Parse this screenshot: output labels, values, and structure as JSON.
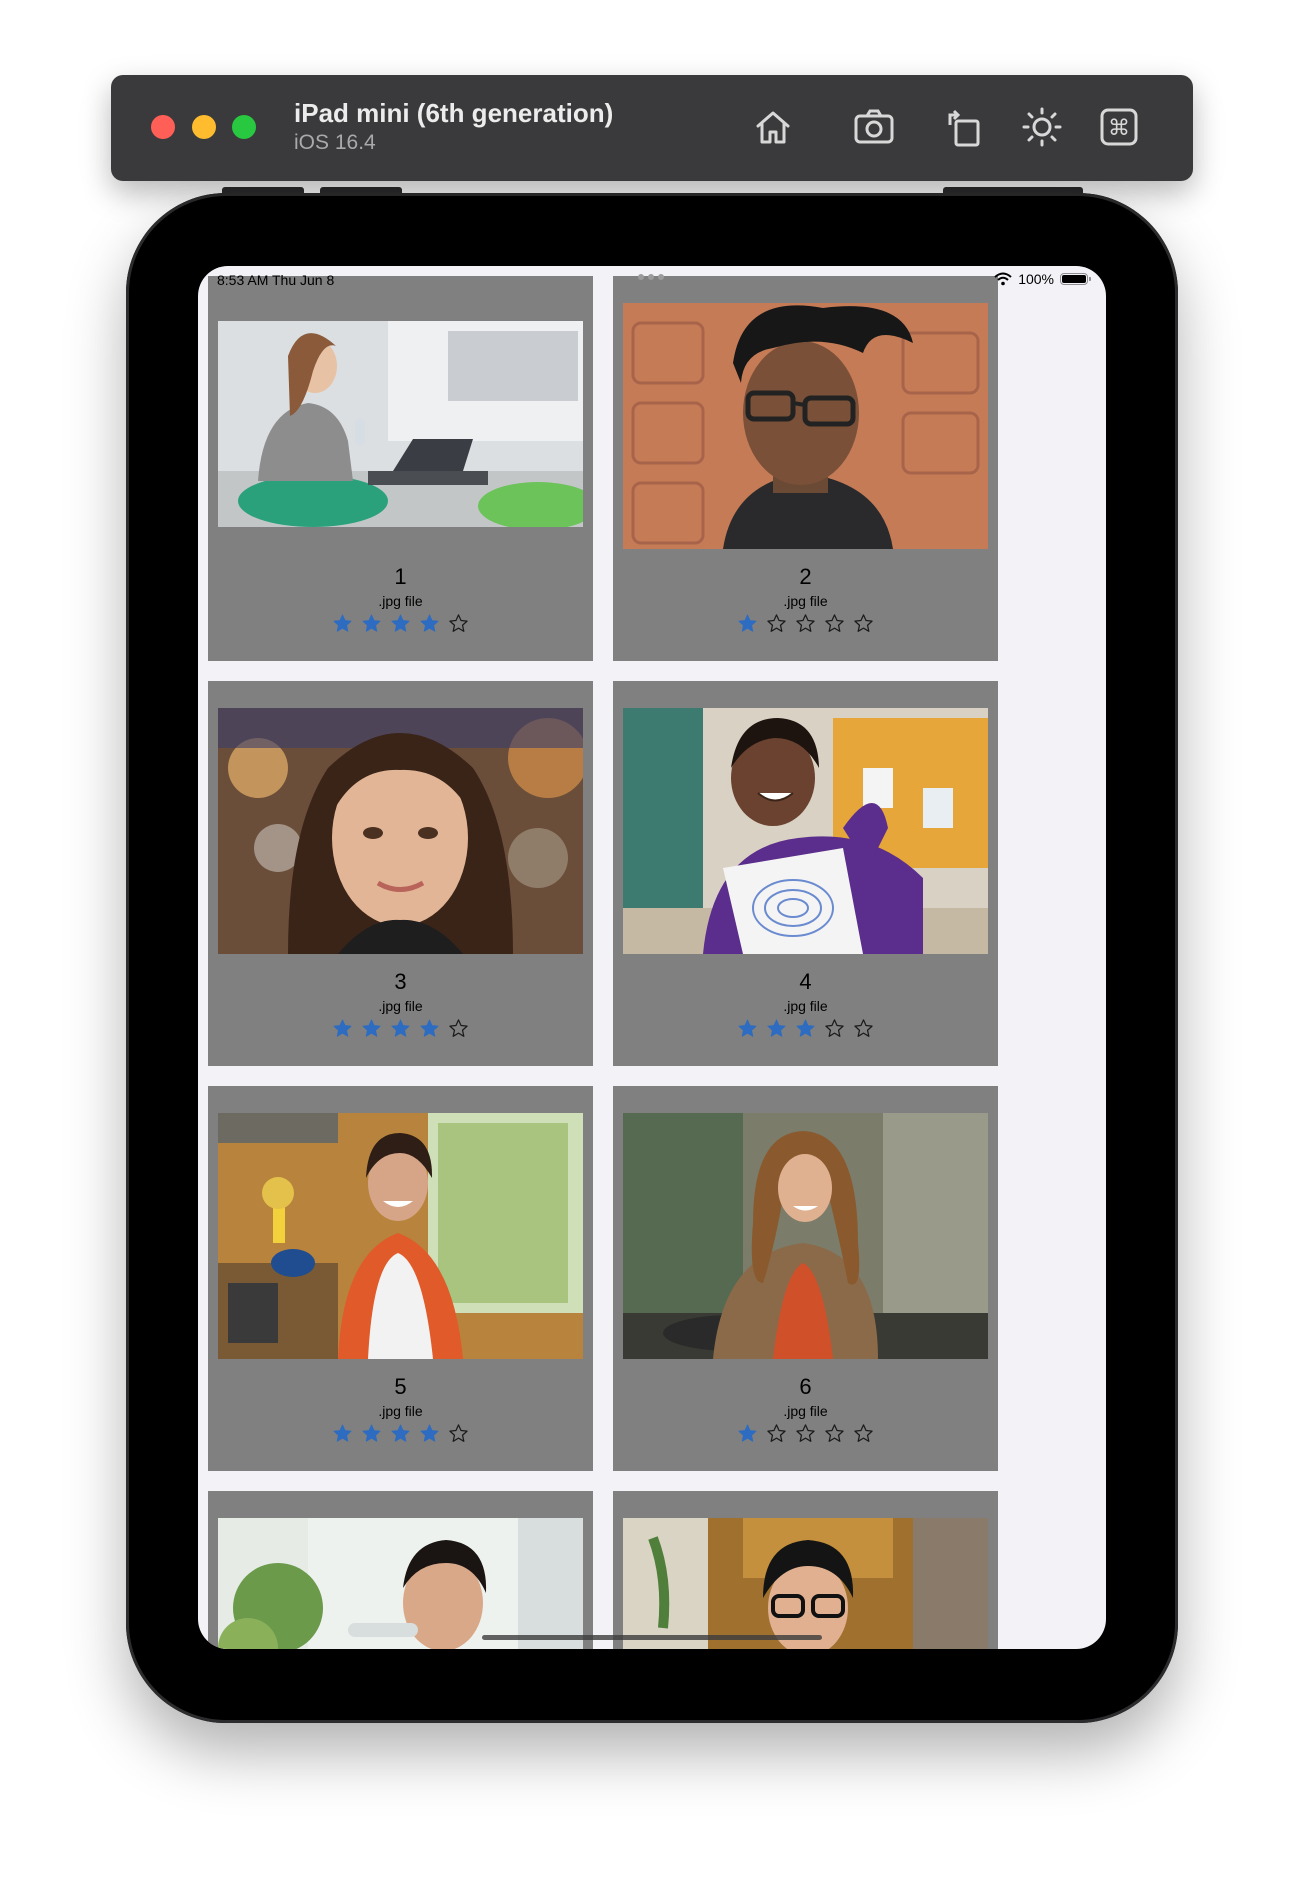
{
  "simulator": {
    "device_name": "iPad mini (6th generation)",
    "os_version": "iOS 16.4",
    "toolbar_icons": [
      "home-icon",
      "screenshot-icon",
      "rotate-icon",
      "appearance-icon",
      "command-icon"
    ]
  },
  "status_bar": {
    "time_date": "8:53 AM   Thu Jun 8",
    "battery_percent": "100%"
  },
  "colors": {
    "card_background": "#808080",
    "star_filled": "#2d6cc0",
    "screen_background": "#f2f2f7"
  },
  "items": [
    {
      "title": "1",
      "subtitle": ".jpg file",
      "rating": 4,
      "photo": "woman-with-tablet-photo"
    },
    {
      "title": "2",
      "subtitle": ".jpg file",
      "rating": 1,
      "photo": "young-man-glasses-photo"
    },
    {
      "title": "3",
      "subtitle": ".jpg file",
      "rating": 4,
      "photo": "woman-bangs-photo"
    },
    {
      "title": "4",
      "subtitle": ".jpg file",
      "rating": 3,
      "photo": "girl-with-drawing-photo"
    },
    {
      "title": "5",
      "subtitle": ".jpg file",
      "rating": 4,
      "photo": "woman-in-kitchen-photo"
    },
    {
      "title": "6",
      "subtitle": ".jpg file",
      "rating": 1,
      "photo": "woman-at-cafe-photo"
    },
    {
      "title": "",
      "subtitle": "",
      "rating": 0,
      "photo": "man-eating-photo"
    },
    {
      "title": "",
      "subtitle": "",
      "rating": 0,
      "photo": "woman-glasses-photo"
    }
  ],
  "max_rating": 5
}
